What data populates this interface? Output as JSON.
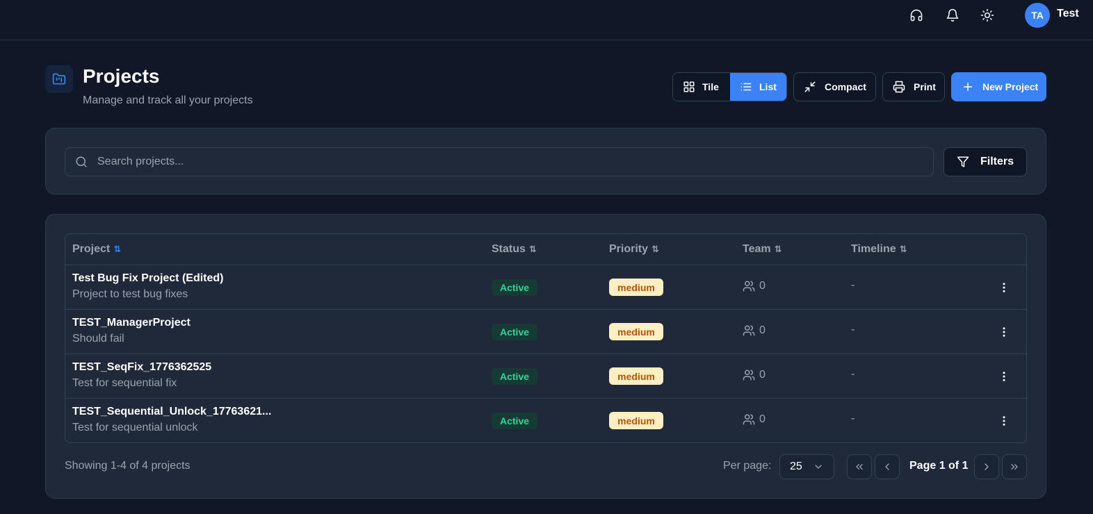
{
  "topbar": {
    "user_initials": "TA",
    "user_name": "Test"
  },
  "header": {
    "title": "Projects",
    "subtitle": "Manage and track all your projects",
    "view_tile_label": "Tile",
    "view_list_label": "List",
    "active_view": "list",
    "compact_label": "Compact",
    "print_label": "Print",
    "new_project_label": "New Project"
  },
  "search": {
    "placeholder": "Search projects...",
    "value": "",
    "filters_label": "Filters"
  },
  "table": {
    "columns": [
      "Project",
      "Status",
      "Priority",
      "Team",
      "Timeline"
    ],
    "sort_icon": "⇅",
    "rows": [
      {
        "name": "Test Bug Fix Project (Edited)",
        "description": "Project to test bug fixes",
        "status": "Active",
        "priority": "medium",
        "team": "0",
        "timeline": "-"
      },
      {
        "name": "TEST_ManagerProject",
        "description": "Should fail",
        "status": "Active",
        "priority": "medium",
        "team": "0",
        "timeline": "-"
      },
      {
        "name": "TEST_SeqFix_1776362525",
        "description": "Test for sequential fix",
        "status": "Active",
        "priority": "medium",
        "team": "0",
        "timeline": "-"
      },
      {
        "name": "TEST_Sequential_Unlock_17763621...",
        "description": "Test for sequential unlock",
        "status": "Active",
        "priority": "medium",
        "team": "0",
        "timeline": "-"
      }
    ]
  },
  "footer": {
    "showing_text": "Showing 1-4 of 4 projects",
    "per_page_label": "Per page:",
    "per_page_value": "25",
    "page_info": "Page 1 of 1"
  },
  "colors": {
    "background": "#101827",
    "card": "#1f2939",
    "accent": "#3b82f6",
    "status_active": "#34d399",
    "priority_medium_bg": "#fdefc3",
    "priority_medium_text": "#b45309"
  }
}
